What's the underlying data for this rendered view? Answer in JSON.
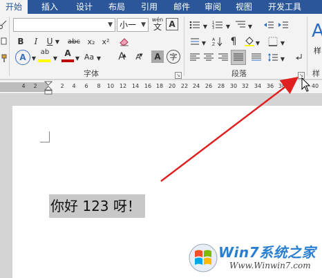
{
  "tabs": [
    "开始",
    "插入",
    "设计",
    "布局",
    "引用",
    "邮件",
    "审阅",
    "视图",
    "开发工具"
  ],
  "font": {
    "name_value": "",
    "size_value": "小一",
    "wen_label": "wén",
    "bold": "B",
    "italic": "I",
    "underline": "U",
    "strike": "abc",
    "sub": "x₂",
    "sup": "x²",
    "clear_icon": "eraser-icon",
    "text_effects": "A",
    "highlight": "ab",
    "font_color": "A",
    "aa_case": "Aa",
    "grow": "A",
    "shrink": "A",
    "char_shade": "A",
    "encircle": "字",
    "char_border": "A",
    "group_label": "字体"
  },
  "paragraph": {
    "group_label": "段落"
  },
  "styles": {
    "group_label": "样",
    "preview": "A",
    "preview_label": "样"
  },
  "ruler_numbers": [
    "4",
    "2",
    "2",
    "4",
    "6",
    "8",
    "10",
    "12",
    "14",
    "16",
    "18",
    "20",
    "22",
    "24",
    "26",
    "28",
    "30",
    "32",
    "34",
    "36",
    "38",
    "40"
  ],
  "document": {
    "sample_text": "你好 123 呀！"
  },
  "watermark": {
    "brand": "Win7系统之家",
    "url": "Www.Winwin7.com"
  },
  "colors": {
    "tab_bar": "#2b579a",
    "highlight_yellow": "#ffff00",
    "font_color_red": "#c00000",
    "arrow_red": "#e02020",
    "text_selection": "#c8c8c8"
  }
}
